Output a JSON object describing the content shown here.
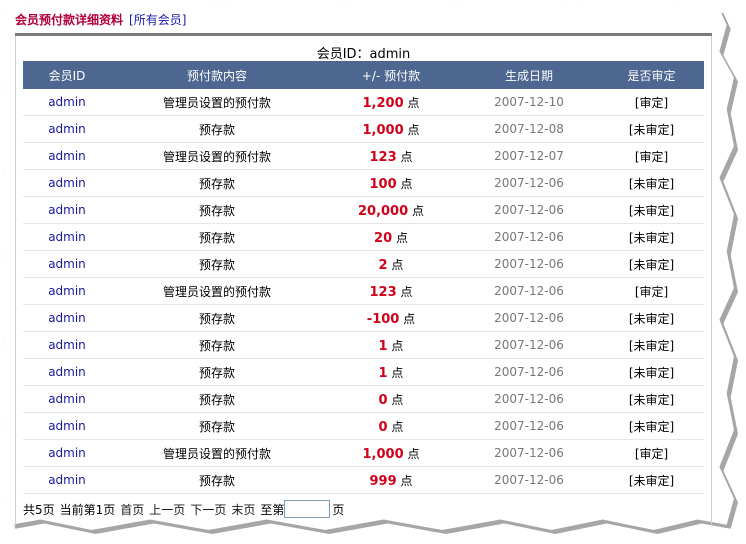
{
  "header": {
    "title": "会员预付款详细资料",
    "all_members_link": "[所有会员]"
  },
  "member_caption": "会员ID：admin",
  "table": {
    "columns": [
      "会员ID",
      "预付款内容",
      "+/- 预付款",
      "生成日期",
      "是否审定"
    ],
    "unit": "点",
    "rows": [
      {
        "member": "admin",
        "content": "管理员设置的预付款",
        "amount": "1,200",
        "date": "2007-12-10",
        "status": "[审定]"
      },
      {
        "member": "admin",
        "content": "预存款",
        "amount": "1,000",
        "date": "2007-12-08",
        "status": "[未审定]"
      },
      {
        "member": "admin",
        "content": "管理员设置的预付款",
        "amount": "123",
        "date": "2007-12-07",
        "status": "[审定]"
      },
      {
        "member": "admin",
        "content": "预存款",
        "amount": "100",
        "date": "2007-12-06",
        "status": "[未审定]"
      },
      {
        "member": "admin",
        "content": "预存款",
        "amount": "20,000",
        "date": "2007-12-06",
        "status": "[未审定]"
      },
      {
        "member": "admin",
        "content": "预存款",
        "amount": "20",
        "date": "2007-12-06",
        "status": "[未审定]"
      },
      {
        "member": "admin",
        "content": "预存款",
        "amount": "2",
        "date": "2007-12-06",
        "status": "[未审定]"
      },
      {
        "member": "admin",
        "content": "管理员设置的预付款",
        "amount": "123",
        "date": "2007-12-06",
        "status": "[审定]"
      },
      {
        "member": "admin",
        "content": "预存款",
        "amount": "-100",
        "date": "2007-12-06",
        "status": "[未审定]"
      },
      {
        "member": "admin",
        "content": "预存款",
        "amount": "1",
        "date": "2007-12-06",
        "status": "[未审定]"
      },
      {
        "member": "admin",
        "content": "预存款",
        "amount": "1",
        "date": "2007-12-06",
        "status": "[未审定]"
      },
      {
        "member": "admin",
        "content": "预存款",
        "amount": "0",
        "date": "2007-12-06",
        "status": "[未审定]"
      },
      {
        "member": "admin",
        "content": "预存款",
        "amount": "0",
        "date": "2007-12-06",
        "status": "[未审定]"
      },
      {
        "member": "admin",
        "content": "管理员设置的预付款",
        "amount": "1,000",
        "date": "2007-12-06",
        "status": "[审定]"
      },
      {
        "member": "admin",
        "content": "预存款",
        "amount": "999",
        "date": "2007-12-06",
        "status": "[未审定]"
      }
    ]
  },
  "pager": {
    "total_pages": "共5页",
    "current_page": "当前第1页",
    "first": "首页",
    "prev": "上一页",
    "next": "下一页",
    "last": "末页",
    "goto_prefix": "至第",
    "goto_value": "",
    "goto_suffix": "页"
  },
  "colors": {
    "title": "#b0003a",
    "table_header_bg": "#4d6790",
    "amount": "#d0021b",
    "member_link": "#1a1a9c"
  }
}
